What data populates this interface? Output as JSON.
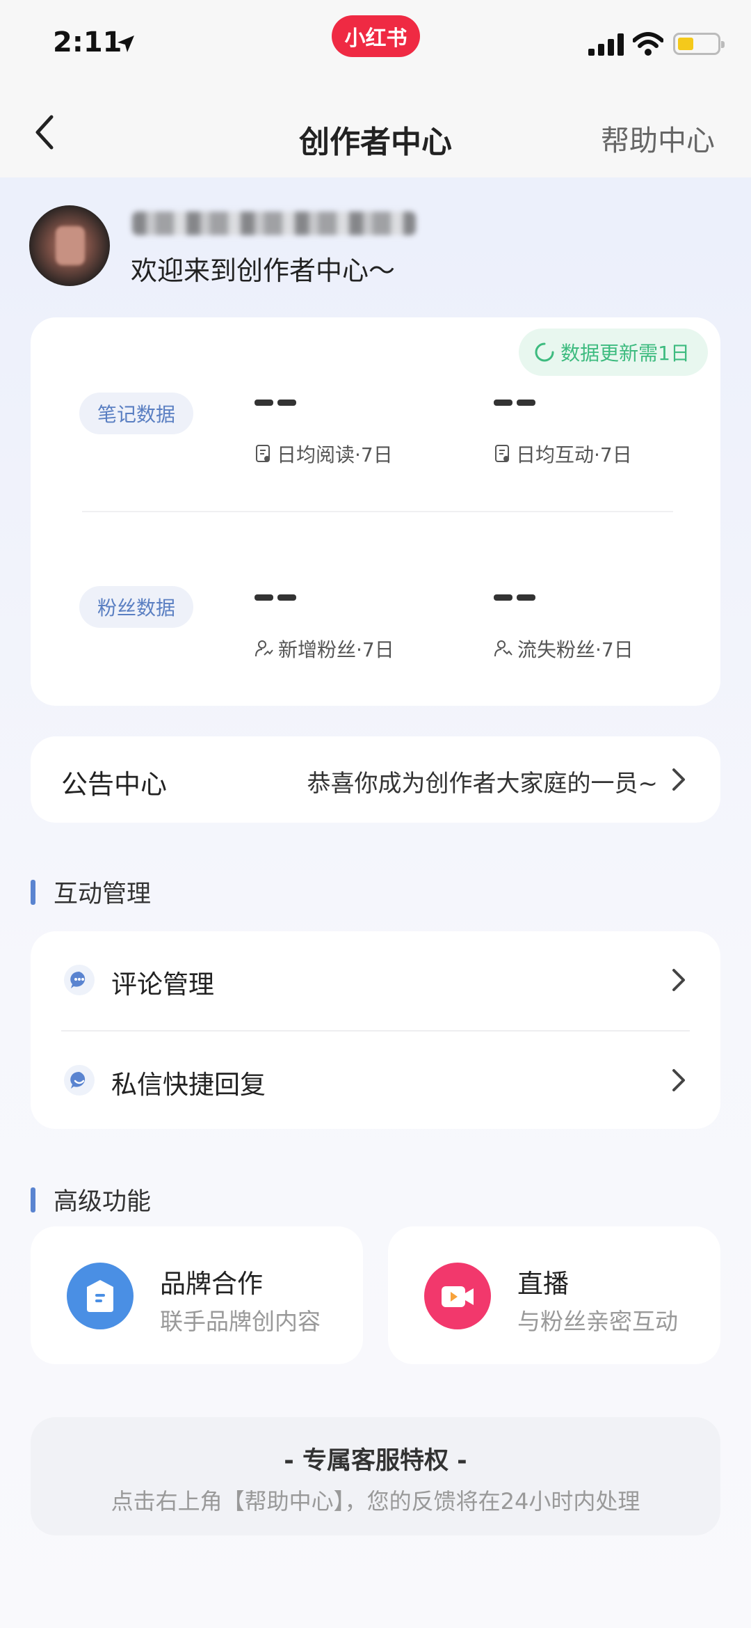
{
  "status_bar": {
    "time": "2:11",
    "brand_badge": "小红书"
  },
  "nav": {
    "title": "创作者中心",
    "help": "帮助中心"
  },
  "profile": {
    "welcome": "欢迎来到创作者中心～"
  },
  "data_card": {
    "update_badge": "数据更新需1日",
    "note_section": {
      "label": "笔记数据",
      "metrics": [
        {
          "value": "--",
          "label": "日均阅读·7日"
        },
        {
          "value": "--",
          "label": "日均互动·7日"
        }
      ]
    },
    "fans_section": {
      "label": "粉丝数据",
      "metrics": [
        {
          "value": "--",
          "label": "新增粉丝·7日"
        },
        {
          "value": "--",
          "label": "流失粉丝·7日"
        }
      ]
    }
  },
  "notice": {
    "title": "公告中心",
    "text": "恭喜你成为创作者大家庭的一员~"
  },
  "interaction": {
    "heading": "互动管理",
    "items": [
      {
        "label": "评论管理"
      },
      {
        "label": "私信快捷回复"
      }
    ]
  },
  "advanced": {
    "heading": "高级功能",
    "features": [
      {
        "title": "品牌合作",
        "subtitle": "联手品牌创内容",
        "color": "#4a8fe4"
      },
      {
        "title": "直播",
        "subtitle": "与粉丝亲密互动",
        "color": "#f2386c"
      }
    ]
  },
  "service": {
    "title": "- 专属客服特权 -",
    "text": "点击右上角【帮助中心】，您的反馈将在24小时内处理"
  },
  "colors": {
    "accent": "#5a84d0",
    "update_green": "#3dbb7f",
    "brand_red": "#ef2a43"
  }
}
